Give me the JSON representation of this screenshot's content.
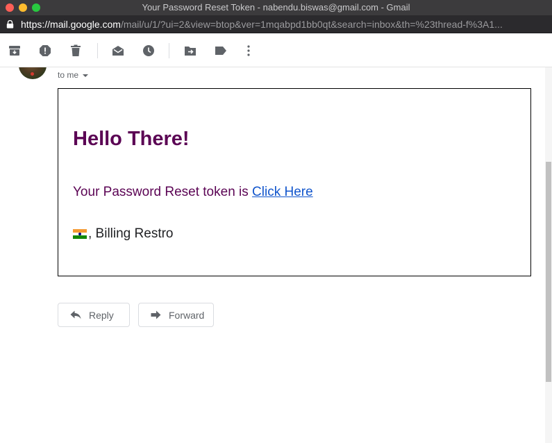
{
  "window": {
    "title": "Your Password Reset Token - nabendu.biswas@gmail.com - Gmail"
  },
  "address_bar": {
    "protocol": "https://",
    "host": "mail.google.com",
    "path": "/mail/u/1/?ui=2&view=btop&ver=1mqabpd1bb0qt&search=inbox&th=%23thread-f%3A1..."
  },
  "toolbar": {
    "icons": [
      "archive-icon",
      "report-spam-icon",
      "delete-icon",
      "mark-unread-icon",
      "snooze-icon",
      "move-to-icon",
      "labels-icon",
      "more-icon"
    ]
  },
  "message": {
    "recipient_label": "to me",
    "heading": "Hello There!",
    "body_prefix": "Your Password Reset token is ",
    "link_text": "Click Here",
    "signature": ", Billing Restro"
  },
  "actions": {
    "reply_label": "Reply",
    "forward_label": "Forward"
  },
  "colors": {
    "heading": "#5b0454",
    "link": "#1155cc",
    "titlebar": "#3c3b3d"
  }
}
